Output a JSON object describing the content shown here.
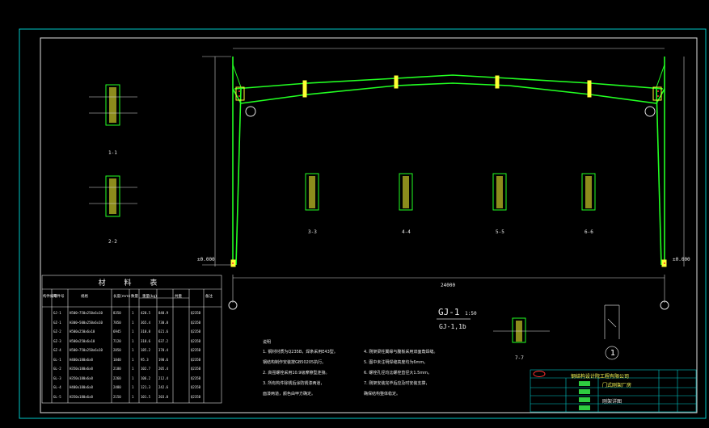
{
  "drawing": {
    "frame_label": "GJ-1",
    "frame_scale": "1:50",
    "frame_sub": "GJ-1,1b",
    "material_table_title": "材 料 表",
    "material_headers": [
      "构件编号",
      "零件号",
      "规格",
      "长度(mm)",
      "数量",
      "重量(kg)",
      "共重",
      "备注"
    ],
    "material_rows": [
      [
        "GJ-1",
        "H500~750x250x6x10",
        "8350",
        "1",
        "420.5",
        "840.9",
        "Q235B"
      ],
      [
        "GZ-1",
        "H300~500x250x6x10",
        "7850",
        "1",
        "365.4",
        "730.8",
        "Q235B"
      ],
      [
        "GZ-2",
        "H500x250x6x10",
        "6945",
        "1",
        "310.8",
        "621.6",
        "Q235B"
      ],
      [
        "GZ-3",
        "H500x250x6x10",
        "7120",
        "1",
        "318.6",
        "637.2",
        "Q235B"
      ],
      [
        "GZ-4",
        "H500~750x250x6x10",
        "2850",
        "1",
        "185.2",
        "370.4",
        "Q235B"
      ],
      [
        "GL-1",
        "H400x180x6x8",
        "1840",
        "1",
        "95.3",
        "190.6",
        "Q235B"
      ],
      [
        "GL-2",
        "H350x180x6x8",
        "2180",
        "1",
        "102.7",
        "205.4",
        "Q235B"
      ],
      [
        "GL-3",
        "H350x180x6x8",
        "2260",
        "1",
        "106.2",
        "212.4",
        "Q235B"
      ],
      [
        "GL-4",
        "H400x180x6x8",
        "2480",
        "1",
        "121.3",
        "242.6",
        "Q235B"
      ],
      [
        "GL-5",
        "H350x180x6x8",
        "2150",
        "1",
        "101.5",
        "203.0",
        "Q235B"
      ]
    ],
    "section_labels": [
      "1-1",
      "2-2",
      "3-3",
      "4-4",
      "5-5",
      "6-6",
      "7-7"
    ],
    "notes_title": "说明",
    "notes": [
      "1. 钢材材质为Q235B，焊条采用E43型。",
      "   钢结构制作安装按GB50205执行。",
      "2. 高强螺栓采用10.9级摩擦型连接。",
      "3. 所有构件除锈后涂防锈漆两道，",
      "   面漆两道，颜色由甲方确定。"
    ],
    "notes_right": [
      "4. 刚架梁柱翼缘与腹板采用双面角焊缝。",
      "5. 图中未注明焊缝高度均为6mm。",
      "6. 螺栓孔径均比螺栓直径大1.5mm。",
      "7. 刚架安装完毕后应及时安装支撑，",
      "   确保结构整体稳定。"
    ],
    "titleblock_company": "钢结构设计院工程有限公司",
    "titleblock_project": "门式刚架厂房",
    "titleblock_drawing": "刚架详图",
    "circle_number": "1",
    "elevation_left_top": "±0.000",
    "elevation_right_top": "±0.000",
    "dim_total": "24000",
    "colors": {
      "frame": "#00ff00",
      "border": "#00d8d8",
      "dim": "#d0d0d0",
      "plate": "#ffff00",
      "bolt": "#ff4040"
    }
  }
}
